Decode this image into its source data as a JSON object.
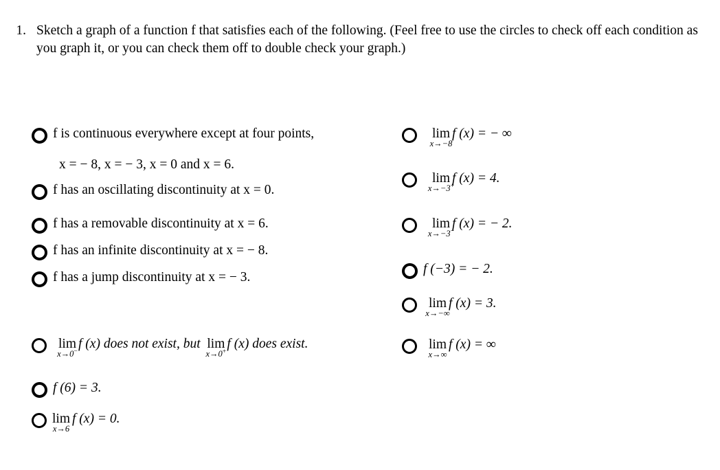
{
  "prompt": {
    "number": "1.",
    "text": "Sketch a graph of a function f that satisfies each of the following. (Feel free to use the circles to check off each condition as you graph it, or you can check them off to double check your graph.)"
  },
  "left_column": {
    "items": [
      {
        "id": "continuous-except-four-points",
        "kind": "text",
        "text": "f is continuous everywhere except at four points,",
        "continuation": "x = − 8, x = − 3, x = 0 and x = 6."
      },
      {
        "id": "oscillating-discontinuity",
        "kind": "text",
        "text": "f has an oscillating discontinuity at x = 0."
      },
      {
        "id": "removable-discontinuity",
        "kind": "text",
        "text": "f has a removable discontinuity at x = 6."
      },
      {
        "id": "infinite-discontinuity",
        "kind": "text",
        "text": "f has an infinite discontinuity at x = − 8."
      },
      {
        "id": "jump-discontinuity",
        "kind": "text",
        "text": "f has a jump discontinuity at x = − 3."
      },
      {
        "id": "one-sided-limits-at-zero",
        "kind": "limit-pair",
        "lim1": {
          "op": "lim",
          "sub": "x→0",
          "sub_sup": "−"
        },
        "mid": "f (x) does not exist, but",
        "lim2": {
          "op": "lim",
          "sub": "x→0",
          "sub_sup": "+"
        },
        "tail": "f (x) does exist."
      },
      {
        "id": "f-of-six",
        "kind": "text",
        "text": "f (6) = 3."
      },
      {
        "id": "limit-at-six",
        "kind": "limit",
        "lim": {
          "op": "lim",
          "sub": "x→6",
          "sub_sup": ""
        },
        "tail": "f (x) = 0."
      }
    ]
  },
  "right_column": {
    "items": [
      {
        "id": "limit-at-neg-eight",
        "kind": "limit",
        "lim": {
          "op": "lim",
          "sub": "x→−8",
          "sub_sup": ""
        },
        "tail": "f (x) = − ∞"
      },
      {
        "id": "limit-neg-three-from-right",
        "kind": "limit",
        "lim": {
          "op": "lim",
          "sub": "x→−3",
          "sub_sup": "+"
        },
        "tail": "f (x) = 4."
      },
      {
        "id": "limit-neg-three-from-left",
        "kind": "limit",
        "lim": {
          "op": "lim",
          "sub": "x→−3",
          "sub_sup": "−"
        },
        "tail": "f (x) = − 2."
      },
      {
        "id": "f-of-neg-three",
        "kind": "text",
        "text": "f (−3) = − 2."
      },
      {
        "id": "limit-at-neg-infinity",
        "kind": "limit",
        "lim": {
          "op": "lim",
          "sub": "x→−∞",
          "sub_sup": ""
        },
        "tail": "f (x) = 3."
      },
      {
        "id": "limit-at-pos-infinity",
        "kind": "limit",
        "lim": {
          "op": "lim",
          "sub": "x→∞",
          "sub_sup": ""
        },
        "tail": "f (x) = ∞"
      }
    ]
  },
  "colors": {
    "background": "#ffffff",
    "ink": "#000000"
  }
}
